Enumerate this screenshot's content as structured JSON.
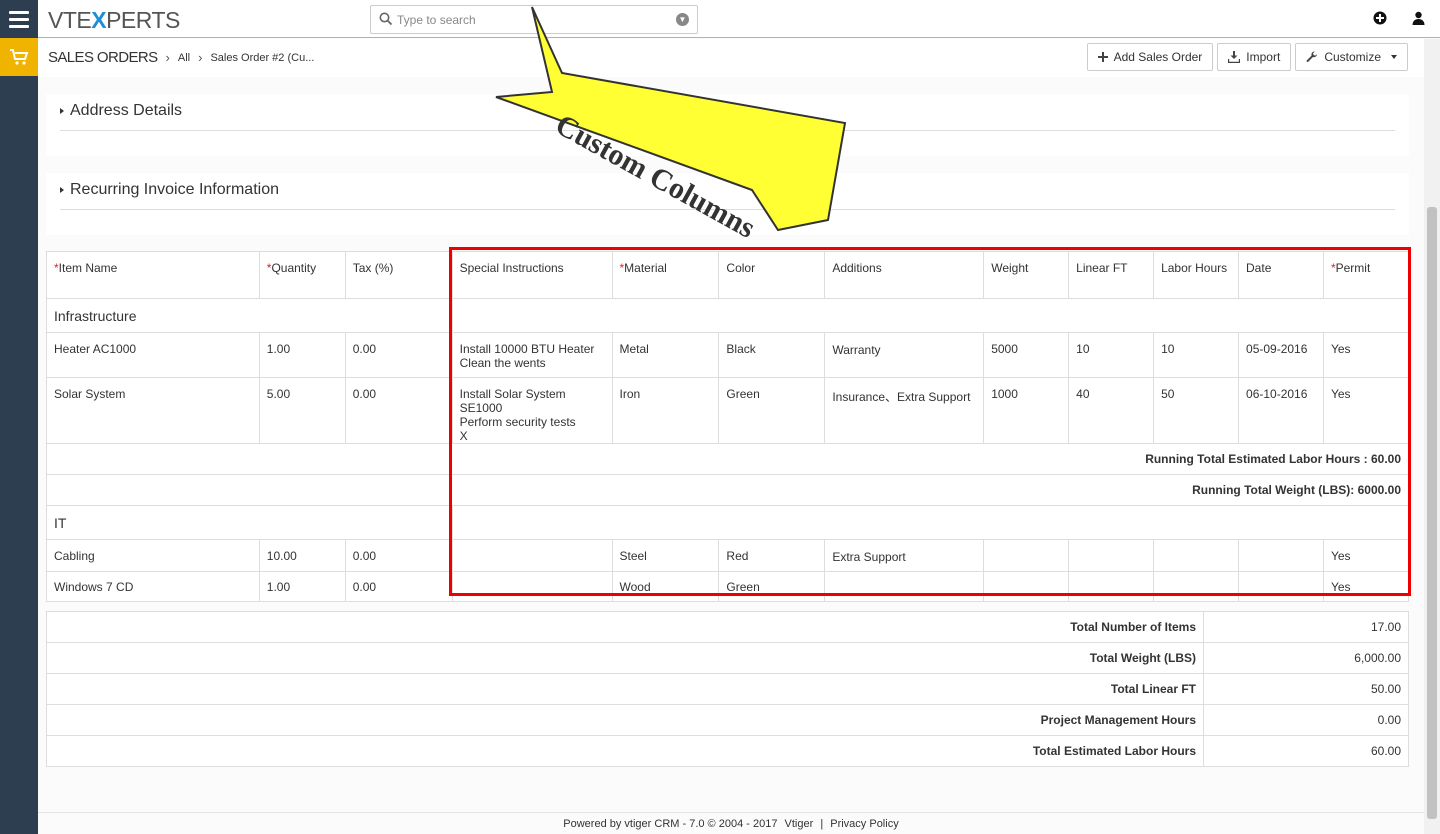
{
  "app": {
    "logo_prefix": "VTE",
    "logo_x": "X",
    "logo_suffix": "PERTS",
    "search_placeholder": "Type to search"
  },
  "breadcrumb": {
    "module": "SALES ORDERS",
    "filter": "All",
    "record": "Sales Order #2 (Cu..."
  },
  "actions": {
    "add": "Add Sales Order",
    "import": "Import",
    "customize": "Customize"
  },
  "blocks": {
    "address": "Address Details",
    "recurring": "Recurring Invoice Information"
  },
  "annotation": {
    "callout": "Custom Columns"
  },
  "items_table": {
    "headers": {
      "item_name": "Item Name",
      "quantity": "Quantity",
      "tax": "Tax (%)",
      "special": "Special Instructions",
      "material": "Material",
      "color": "Color",
      "additions": "Additions",
      "weight": "Weight",
      "linear": "Linear FT",
      "labor": "Labor Hours",
      "date": "Date",
      "permit": "Permit"
    },
    "required_mark": "*",
    "groups": [
      {
        "name": "Infrastructure",
        "rows": [
          {
            "name": "Heater AC1000",
            "qty": "1.00",
            "tax": "0.00",
            "special_1": "Install 10000 BTU Heater",
            "special_2": "Clean the wents",
            "special_3": "",
            "material": "Metal",
            "color": "Black",
            "additions": "Warranty",
            "weight": "5000",
            "linear": "10",
            "labor": "10",
            "date": "05-09-2016",
            "permit": "Yes"
          },
          {
            "name": "Solar System",
            "qty": "5.00",
            "tax": "0.00",
            "special_1": "Install Solar System SE1000",
            "special_2": "Perform security tests",
            "special_3": "X",
            "material": "Iron",
            "color": "Green",
            "additions": "Insurance、Extra Support",
            "weight": "1000",
            "linear": "40",
            "labor": "50",
            "date": "06-10-2016",
            "permit": "Yes"
          }
        ],
        "running_labor": "Running Total Estimated Labor Hours : 60.00",
        "running_weight": "Running Total Weight (LBS): 6000.00"
      },
      {
        "name": "IT",
        "rows": [
          {
            "name": "Cabling",
            "qty": "10.00",
            "tax": "0.00",
            "material": "Steel",
            "color": "Red",
            "additions": "Extra Support",
            "permit": "Yes"
          },
          {
            "name": "Windows 7 CD",
            "qty": "1.00",
            "tax": "0.00",
            "material": "Wood",
            "color": "Green",
            "additions": "",
            "permit": "Yes"
          }
        ]
      }
    ]
  },
  "summary": [
    {
      "label": "Total Number of Items",
      "value": "17.00"
    },
    {
      "label": "Total Weight (LBS)",
      "value": "6,000.00"
    },
    {
      "label": "Total Linear FT",
      "value": "50.00"
    },
    {
      "label": "Project Management Hours",
      "value": "0.00"
    },
    {
      "label": "Total Estimated Labor Hours",
      "value": "60.00"
    }
  ],
  "footer": {
    "powered": "Powered by vtiger CRM - 7.0  © 2004 - 2017",
    "vtiger": "Vtiger",
    "divider": "|",
    "privacy": "Privacy Policy"
  },
  "colors": {
    "rail": "#2d3e50",
    "accent": "#f0b400",
    "highlight": "#e00000",
    "arrow": "#ffff33",
    "logo_x": "#1d8fd6"
  },
  "icons": [
    "menu-icon",
    "shopping-cart-icon",
    "search-icon",
    "dropdown-icon",
    "plus-circle-icon",
    "user-icon",
    "plus-icon",
    "import-icon",
    "wrench-icon"
  ]
}
